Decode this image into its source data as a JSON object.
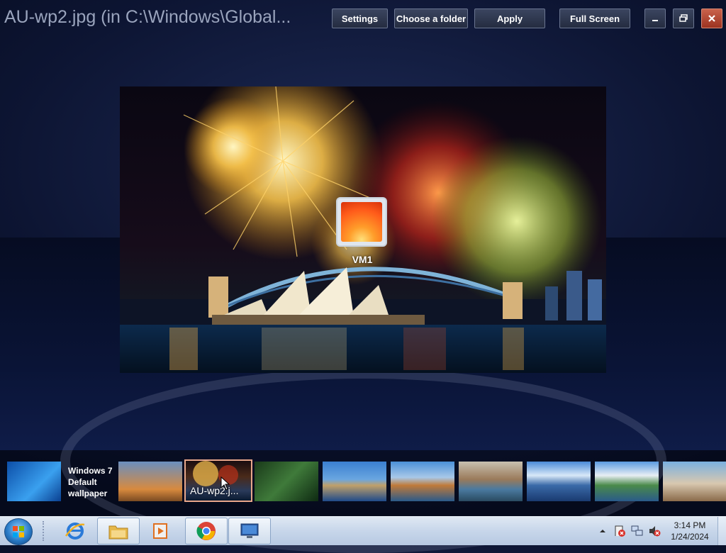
{
  "window": {
    "title": "AU-wp2.jpg (in C:\\Windows\\Global..."
  },
  "toolbar": {
    "settings_label": "Settings",
    "choose_folder_label": "Choose a folder",
    "apply_label": "Apply",
    "fullscreen_label": "Full Screen"
  },
  "desktop_icon": {
    "label": "VM1"
  },
  "thumbnails": [
    {
      "name": "Windows 7 Default wallpaper",
      "caption_line1": "Windows 7",
      "caption_line2": "Default",
      "caption_line3": "wallpaper"
    },
    {
      "name": "baobab-trees"
    },
    {
      "name": "AU-wp2",
      "title": "AU-wp2.j..."
    },
    {
      "name": "rainforest-waterfall"
    },
    {
      "name": "sydney-harbour"
    },
    {
      "name": "coastal-cliffs"
    },
    {
      "name": "rocky-river"
    },
    {
      "name": "mountain-lake"
    },
    {
      "name": "mountain-stream"
    },
    {
      "name": "lighthouse"
    }
  ],
  "taskbar": {
    "clock_time": "3:14 PM",
    "clock_date": "1/24/2024"
  }
}
